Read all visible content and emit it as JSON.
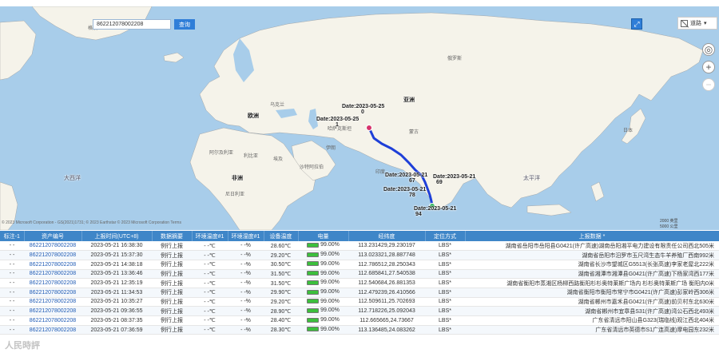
{
  "search": {
    "value": "862212078002208",
    "button": "查询"
  },
  "map": {
    "continent_labels": [
      "亚洲",
      "欧洲",
      "非洲",
      "大西洋",
      "太平洋"
    ],
    "region_names": [
      "格陵兰",
      "蒙古",
      "俄罗斯",
      "哈萨克斯坦",
      "日本",
      "乌克兰",
      "阿尔及利亚",
      "利比亚",
      "埃及",
      "沙特阿拉伯",
      "伊朗",
      "印度",
      "尼日利亚"
    ],
    "route_markers": [
      {
        "label": "Date:2023-05-25",
        "sub": "0"
      },
      {
        "label": "Date:2023-05-25",
        "sub": "1"
      },
      {
        "label": "Date:2023-05-21",
        "sub": "67"
      },
      {
        "label": "Date:2023-05-21",
        "sub": "69"
      },
      {
        "label": "Date:2023-05-21",
        "sub": "78"
      },
      {
        "label": "Date:2023-05-21",
        "sub": "94"
      }
    ],
    "layer_label": "道路",
    "copyright": "© 2023 Microsoft Corporation - GS(2021)1731; © 2023 Earthstar © 2023 Microsoft Corporation Terms",
    "scale_top": "2000 英里",
    "scale_bottom": "5000 公里",
    "route_color": "#1e3fd8",
    "ocean_color": "#a8cdea"
  },
  "table": {
    "columns": [
      "标注-1",
      "资产编号",
      "上报时间(UTC+8)",
      "数据摘要",
      "环境温度#1",
      "环境湿度#1",
      "设备温度",
      "电量",
      "经纬度",
      "定位方式",
      "上报数据 *"
    ],
    "rows": [
      {
        "c0": "- -",
        "asset": "862212078002208",
        "time": "2023-05-21 16:38:30",
        "summary": "例行上报",
        "temp": "- -℃",
        "hum": "- -%",
        "dev": "28.60℃",
        "batt": 99,
        "batt_label": "99.00%",
        "coord": "113.231429,29.230197",
        "mode": "LBS*",
        "addr": "湖南省岳阳市岳阳县G0421(许广高速)湖南岳阳湘平电力建设有限责任公司西北505米"
      },
      {
        "c0": "- -",
        "asset": "862212078002208",
        "time": "2023-05-21 15:37:30",
        "summary": "例行上报",
        "temp": "- -℃",
        "hum": "- -%",
        "dev": "29.20℃",
        "batt": 99,
        "batt_label": "99.00%",
        "coord": "113.023321,28.887748",
        "mode": "LBS*",
        "addr": "湖南省岳阳市汨罗市玉尺湾生态牛羊养殖厂西南992米"
      },
      {
        "c0": "- -",
        "asset": "862212078002208",
        "time": "2023-05-21 14:38:18",
        "summary": "例行上报",
        "temp": "- -℃",
        "hum": "- -%",
        "dev": "30.50℃",
        "batt": 99,
        "batt_label": "99.00%",
        "coord": "112.786512,28.250343",
        "mode": "LBS*",
        "addr": "湖南省长沙市望城区G5513(长张高速)李家老屋北222米"
      },
      {
        "c0": "- -",
        "asset": "862212078002208",
        "time": "2023-05-21 13:36:46",
        "summary": "例行上报",
        "temp": "- -℃",
        "hum": "- -%",
        "dev": "31.50℃",
        "batt": 99,
        "batt_label": "99.00%",
        "coord": "112.685841,27.540538",
        "mode": "LBS*",
        "addr": "湖南省湘潭市湘潭县G0421(许广高速)下杨家湾西177米"
      },
      {
        "c0": "- -",
        "asset": "862212078002208",
        "time": "2023-05-21 12:35:19",
        "summary": "例行上报",
        "temp": "- -℃",
        "hum": "- -%",
        "dev": "31.50℃",
        "batt": 99,
        "batt_label": "99.00%",
        "coord": "112.540684,26.881353",
        "mode": "LBS*",
        "addr": "湖南省衡阳市蒸湘区杨柳西路衡阳杉杉奥特莱斯广场内 杉杉奥特莱斯广场 衡阳内0米"
      },
      {
        "c0": "- -",
        "asset": "862212078002208",
        "time": "2023-05-21 11:34:53",
        "summary": "例行上报",
        "temp": "- -℃",
        "hum": "- -%",
        "dev": "29.90℃",
        "batt": 99,
        "batt_label": "99.00%",
        "coord": "112.479239,26.410566",
        "mode": "LBS*",
        "addr": "湖南省衡阳市衡阳市常宁市G0421(许广高速)彭家岭西306米"
      },
      {
        "c0": "- -",
        "asset": "862212078002208",
        "time": "2023-05-21 10:35:27",
        "summary": "例行上报",
        "temp": "- -℃",
        "hum": "- -%",
        "dev": "29.20℃",
        "batt": 99,
        "batt_label": "99.00%",
        "coord": "112.509611,25.702693",
        "mode": "LBS*",
        "addr": "湖南省郴州市嘉禾县G0421(许广高速)前贝村东北630米"
      },
      {
        "c0": "- -",
        "asset": "862212078002208",
        "time": "2023-05-21 09:36:55",
        "summary": "例行上报",
        "temp": "- -℃",
        "hum": "- -%",
        "dev": "28.90℃",
        "batt": 99,
        "batt_label": "99.00%",
        "coord": "112.718226,25.092043",
        "mode": "LBS*",
        "addr": "湖南省郴州市宜章县S31(许广高速)湾公石西北493米"
      },
      {
        "c0": "- -",
        "asset": "862212078002208",
        "time": "2023-05-21 08:37:35",
        "summary": "例行上报",
        "temp": "- -℃",
        "hum": "- -%",
        "dev": "28.40℃",
        "batt": 99,
        "batt_label": "99.00%",
        "coord": "112.665665,24.73667",
        "mode": "LBS*",
        "addr": "广东省清远市阳山县G323(瑞临线)观江西北404米"
      },
      {
        "c0": "- -",
        "asset": "862212078002208",
        "time": "2023-05-21 07:36:59",
        "summary": "例行上报",
        "temp": "- -℃",
        "hum": "- -%",
        "dev": "28.30℃",
        "batt": 99,
        "batt_label": "99.00%",
        "coord": "113.136485,24.083262",
        "mode": "LBS*",
        "addr": "广东省清远市英德市S1广连高速)摩电园东232米"
      }
    ]
  },
  "watermark": "人民時評"
}
